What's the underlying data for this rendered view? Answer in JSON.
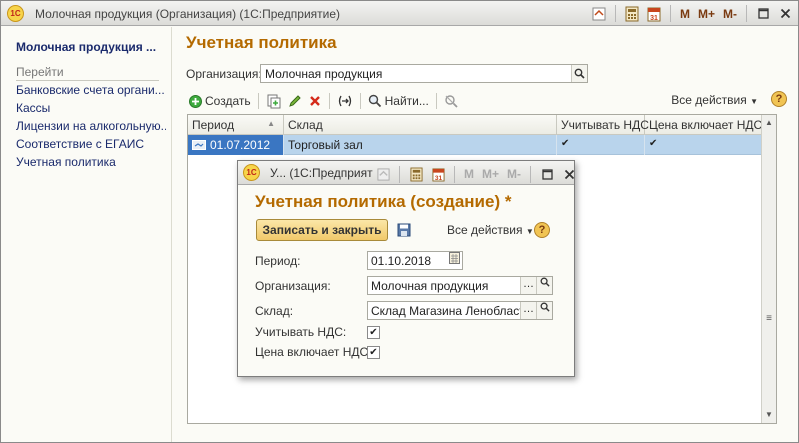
{
  "window": {
    "title": "Молочная продукция (Организация)  (1С:Предприятие)",
    "logo": "1С",
    "m_labels": [
      "M",
      "M+",
      "M-"
    ]
  },
  "sidebar": {
    "title": "Молочная продукция ...",
    "go_label": "Перейти",
    "items": [
      {
        "label": "Банковские счета органи..."
      },
      {
        "label": "Кассы"
      },
      {
        "label": "Лицензии на алкогольную..."
      },
      {
        "label": "Соответствие с ЕГАИС"
      },
      {
        "label": "Учетная политика"
      }
    ]
  },
  "main": {
    "title": "Учетная политика",
    "org_label": "Организация:",
    "org_value": "Молочная продукция",
    "toolbar": {
      "create_label": "Создать",
      "find_label": "Найти...",
      "all_actions": "Все действия",
      "help": "?"
    },
    "table": {
      "columns": [
        "Период",
        "Склад",
        "Учитывать НДС",
        "Цена включает НДС"
      ],
      "rows": [
        {
          "period": "01.07.2012",
          "warehouse": "Торговый зал",
          "vat": "✔",
          "price_incl_vat": "✔"
        }
      ]
    }
  },
  "dialog": {
    "window_title": "У...  (1С:Предприят",
    "heading": "Учетная политика (создание) *",
    "save_close_label": "Записать и закрыть",
    "all_actions": "Все действия",
    "help": "?",
    "fields": {
      "period_label": "Период:",
      "period_value": "01.10.2018",
      "org_label": "Организация:",
      "org_value": "Молочная продукция",
      "warehouse_label": "Склад:",
      "warehouse_value": "Склад Магазина Ленобласть",
      "vat_label": "Учитывать НДС:",
      "vat_checked": "✔",
      "price_incl_vat_label": "Цена включает НДС:",
      "price_incl_vat_checked": "✔"
    }
  },
  "colors": {
    "accent": "#b46a00",
    "link": "#1a2a6c",
    "row_selected": "#b9d4ec",
    "cell_selected": "#3a76c2"
  }
}
